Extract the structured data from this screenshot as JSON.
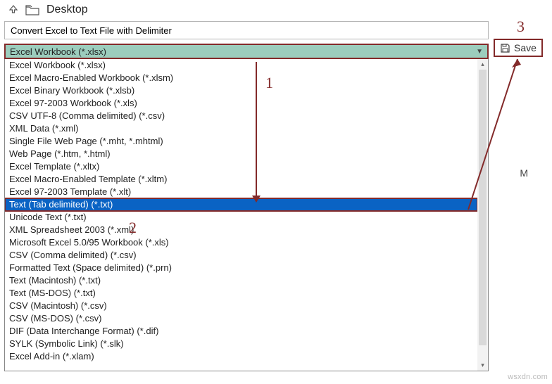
{
  "header": {
    "location": "Desktop"
  },
  "filename": "Convert Excel to Text File with Delimiter",
  "dropdown": {
    "selected": "Excel Workbook (*.xlsx)",
    "options": [
      "Excel Workbook (*.xlsx)",
      "Excel Macro-Enabled Workbook (*.xlsm)",
      "Excel Binary Workbook (*.xlsb)",
      "Excel 97-2003 Workbook (*.xls)",
      "CSV UTF-8 (Comma delimited) (*.csv)",
      "XML Data (*.xml)",
      "Single File Web Page (*.mht, *.mhtml)",
      "Web Page (*.htm, *.html)",
      "Excel Template (*.xltx)",
      "Excel Macro-Enabled Template (*.xltm)",
      "Excel 97-2003 Template (*.xlt)",
      "Text (Tab delimited) (*.txt)",
      "Unicode Text (*.txt)",
      "XML Spreadsheet 2003 (*.xml)",
      "Microsoft Excel 5.0/95 Workbook (*.xls)",
      "CSV (Comma delimited) (*.csv)",
      "Formatted Text (Space delimited) (*.prn)",
      "Text (Macintosh) (*.txt)",
      "Text (MS-DOS) (*.txt)",
      "CSV (Macintosh) (*.csv)",
      "CSV (MS-DOS) (*.csv)",
      "DIF (Data Interchange Format) (*.dif)",
      "SYLK (Symbolic Link) (*.slk)",
      "Excel Add-in (*.xlam)"
    ],
    "selectedIndex": 11
  },
  "save": {
    "label": "Save"
  },
  "annotations": {
    "n1": "1",
    "n2": "2",
    "n3": "3"
  },
  "stray": {
    "m": "M"
  },
  "watermark": "wsxdn.com"
}
